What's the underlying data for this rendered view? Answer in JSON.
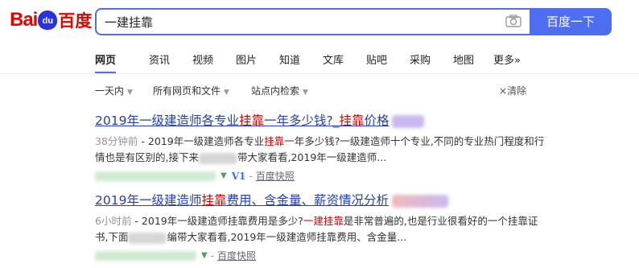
{
  "logo": {
    "part1": "Bai",
    "part2": "du",
    "part3": "百度"
  },
  "search": {
    "query": "一建挂靠",
    "button": "百度一下"
  },
  "tabs": [
    "网页",
    "资讯",
    "视频",
    "图片",
    "知道",
    "文库",
    "贴吧",
    "采购",
    "地图",
    "更多»"
  ],
  "filters": {
    "time": "一天内",
    "type": "所有网页和文件",
    "site": "站点内检索",
    "clear": "清除"
  },
  "results": [
    {
      "title_pre": "2019年一级建造师各专业",
      "title_hl": "挂靠",
      "title_mid": "一年多少钱?_",
      "title_hl2": "挂靠",
      "title_post": "价格",
      "time": "38分钟前",
      "snip_pre": " - 2019年一级建造师各专业",
      "snip_hl": "挂靠",
      "snip_post": "一年多少钱?一级建造师十个专业,不同的专业热门程度和行情也是有区别的,接下来",
      "snip_post2": "带大家看看,2019年一级建造师...",
      "v_mark": "V1",
      "snapshot": "百度快照"
    },
    {
      "title_pre": "2019年一级建造师",
      "title_hl": "挂靠",
      "title_post": "费用、含金量、薪资情况分析",
      "time": "6小时前",
      "snip_pre": " - 2019年一级建造师挂靠费用是多少?",
      "snip_hl": "一建挂靠",
      "snip_post": "是非常普遍的,也是行业很看好的一个挂靠证书,下面",
      "snip_post2": "编带大家看看,2019年一级建造师挂靠费用、含金量...",
      "snapshot": "百度快照"
    }
  ],
  "sep": "-",
  "clear_icon": "×"
}
